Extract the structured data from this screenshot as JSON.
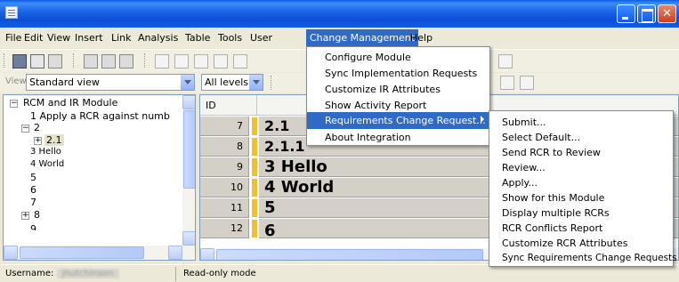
{
  "window": {
    "app_icon": "document-icon",
    "buttons": {
      "minimize": "minimize-icon",
      "maximize": "maximize-icon",
      "close": "close-icon"
    },
    "close_symbol": "✕"
  },
  "menubar": {
    "items": [
      "File",
      "Edit",
      "View",
      "Insert",
      "Link",
      "Analysis",
      "Table",
      "Tools",
      "User",
      "Change Management",
      "Help"
    ],
    "active": "Change Management"
  },
  "toolbar": {
    "view_label": "View",
    "view_select": "Standard view",
    "level_select": "All levels"
  },
  "tree": {
    "root": "RCM and IR Module",
    "items": [
      {
        "label": "1 Apply a RCR against numb"
      },
      {
        "label": "2"
      },
      {
        "label": "2.1"
      },
      {
        "label": "3 Hello"
      },
      {
        "label": "4 World"
      },
      {
        "label": "5"
      },
      {
        "label": "6"
      },
      {
        "label": "7"
      },
      {
        "label": "8"
      },
      {
        "label": "9"
      }
    ]
  },
  "grid": {
    "header_id": "ID",
    "rows": [
      {
        "id": "7",
        "text": "2.1"
      },
      {
        "id": "8",
        "text": "2.1.1"
      },
      {
        "id": "9",
        "text": "3 Hello"
      },
      {
        "id": "10",
        "text": "4 World"
      },
      {
        "id": "11",
        "text": "5"
      },
      {
        "id": "12",
        "text": "6"
      }
    ]
  },
  "change_management_menu": {
    "items": [
      "Configure Module",
      "Sync Implementation Requests",
      "Customize IR Attributes",
      "Show Activity Report",
      "Requirements Change Request...",
      "About Integration"
    ],
    "highlighted": "Requirements Change Request..."
  },
  "rcr_submenu": {
    "items": [
      "Submit...",
      "Select Default...",
      "Send RCR to Review",
      "Review...",
      "Apply...",
      "Show for this Module",
      "Display multiple RCRs",
      "RCR Conflicts Report",
      "Customize RCR Attributes",
      "Sync Requirements Change Requests"
    ]
  },
  "statusbar": {
    "username_label": "Username:",
    "username_value": "jhutchinson",
    "mode": "Read-only mode"
  },
  "colors": {
    "titlebar": "#0b4fd6",
    "highlight": "#316ac5",
    "row_marker": "#f0c030"
  }
}
